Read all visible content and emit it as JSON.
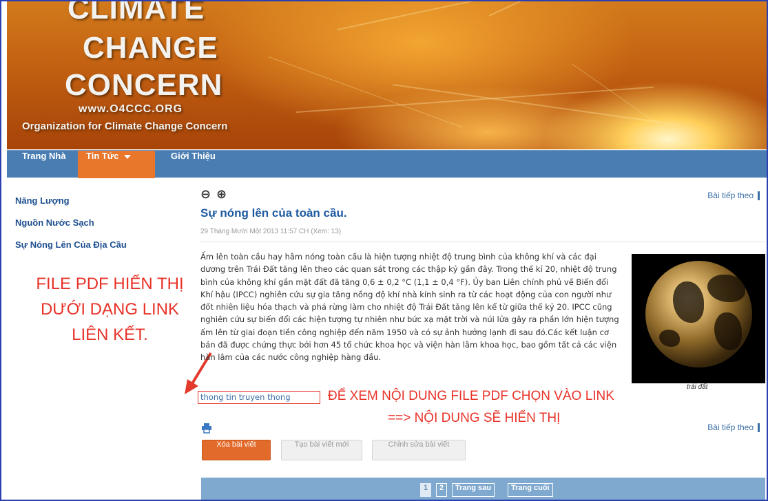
{
  "banner": {
    "logo_line1": "CLIMATE",
    "logo_line2": "CHANGE",
    "logo_line3": "CONCERN",
    "url": "www.O4CCC.ORG",
    "org": "Organization for Climate Change Concern"
  },
  "nav": {
    "home": "Trang Nhà",
    "news": "Tin Tức",
    "about": "Giới Thiệu"
  },
  "sidebar": {
    "items": [
      {
        "label": "Năng Lượng"
      },
      {
        "label": "Nguồn Nước Sạch"
      },
      {
        "label": "Sự Nóng Lên Của Địa Cầu"
      }
    ]
  },
  "annotations": {
    "left": "FILE PDF HIỂN THỊ DƯỚI DẠNG LINK LIÊN KẾT.",
    "right_line1": "ĐỂ XEM NỘI DUNG FILE PDF CHỌN VÀO LINK",
    "right_line2": "==> NỘI DUNG SẼ HIỂN THỊ"
  },
  "article": {
    "next_label": "Bài tiếp theo",
    "title": "Sự nóng lên của toàn cầu.",
    "meta": "29 Tháng Mười Một 2013  11:57 CH  (Xem: 13)",
    "body": "Ấm lên toàn cầu hay hâm nóng toàn cầu là hiện tượng nhiệt độ trung bình của không khí và các đại dương trên Trái Đất tăng lên theo các quan sát trong các thập kỷ gần đây. Trong thế kỉ 20, nhiệt độ trung bình của không khí gần mặt đất đã tăng 0,6 ± 0,2 °C (1,1 ± 0,4 °F). Ủy ban Liên chính phủ về Biến đổi Khí hậu (IPCC) nghiên cứu sự gia tăng nồng độ khí nhà kính sinh ra từ các hoạt động của con người như đốt nhiên liệu hóa thạch và phá rừng làm cho nhiệt độ Trái Đất tăng lên kể từ giữa thế kỷ 20. IPCC cũng nghiên cứu sự biến đổi các hiện tượng tự nhiên như bức xạ mặt trời và núi lửa gây ra phần lớn hiện tượng ấm lên từ giai đoạn tiền công nghiệp đến năm 1950 và có sự ảnh hưởng lạnh đi sau đó.Các kết luận cơ bản đã được chứng thực bởi hơn 45 tổ chức khoa học và viện hàn lâm khoa học, bao gồm tất cả các viện hàn lâm của các nước công nghiệp hàng đầu.",
    "image_caption": "trái đất",
    "link_text": "thong tin truyen thong"
  },
  "buttons": {
    "delete": "Xóa bài viết",
    "new": "Tạo bài viết mới",
    "edit": "Chỉnh sửa bài viết"
  },
  "pager": {
    "page1": "1",
    "page2": "2",
    "next": "Trang sau",
    "last": "Trang cuối"
  },
  "colors": {
    "nav_bg": "#4a7eb3",
    "nav_active": "#e8762b",
    "link": "#1e5aa0",
    "annotation": "#e8332a",
    "delete_button": "#e26a2b",
    "pager_bg": "#7fa9cf"
  }
}
